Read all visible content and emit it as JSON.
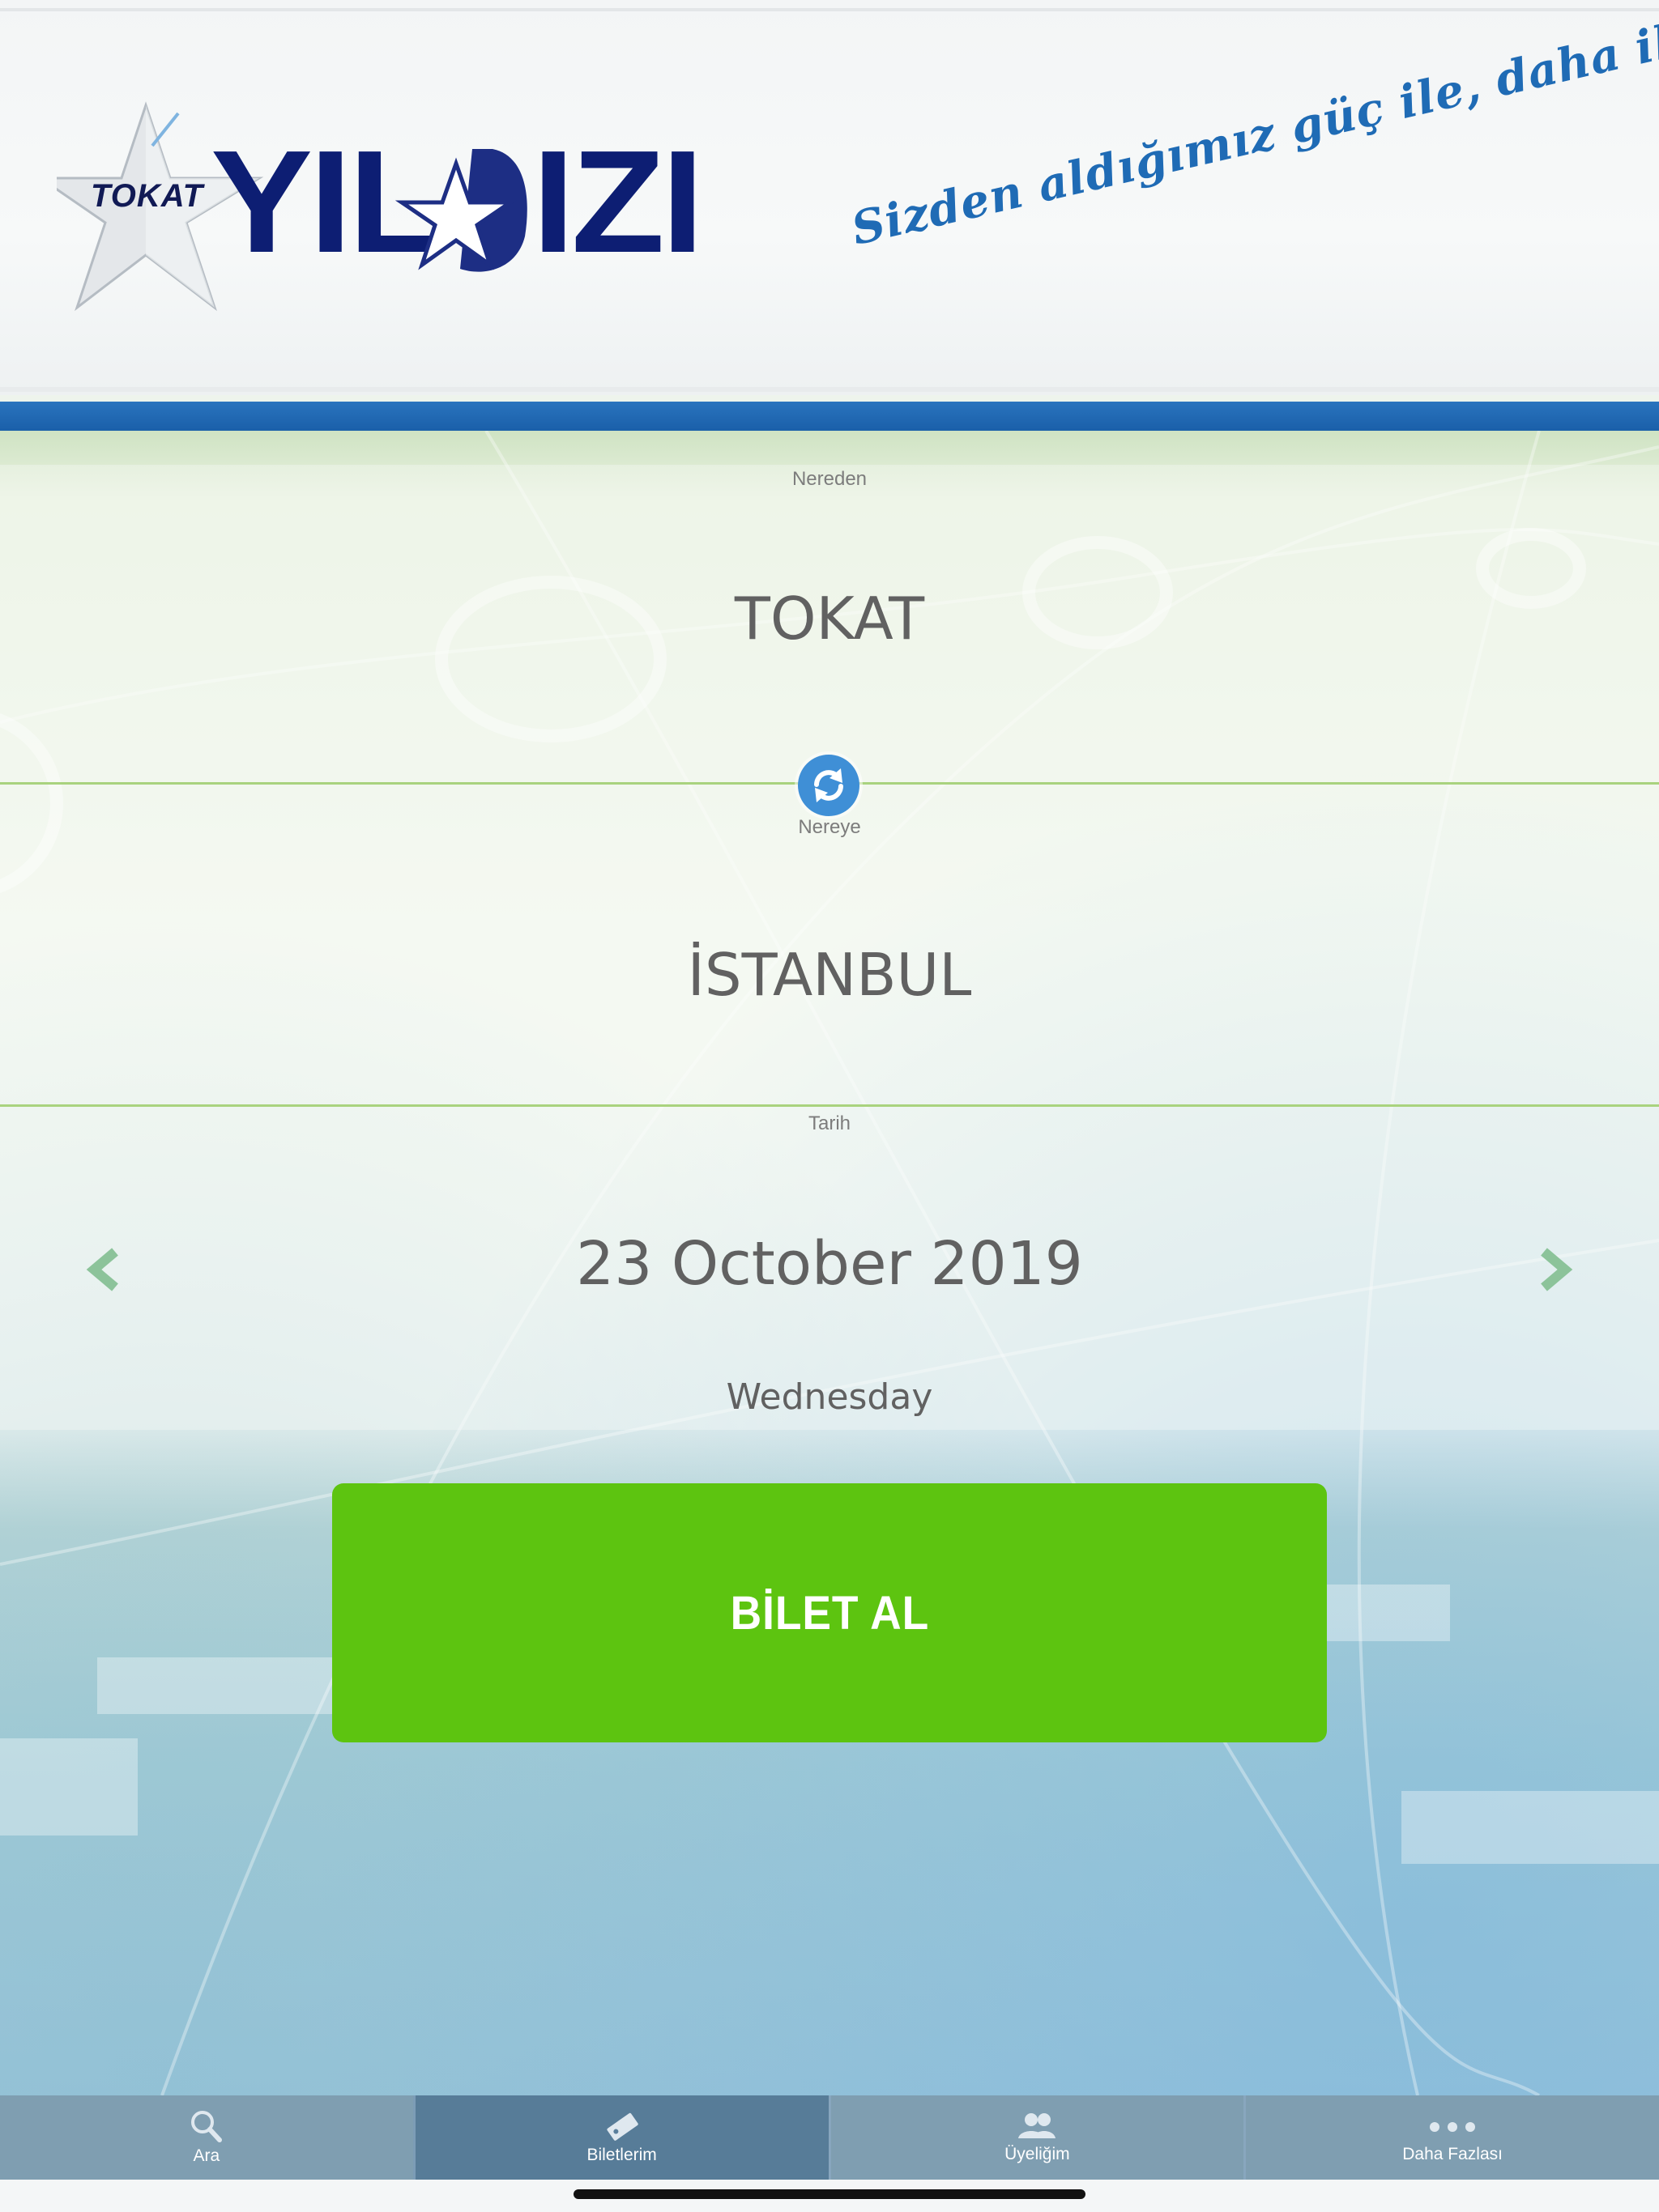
{
  "header": {
    "brand_small": "TOKAT",
    "brand_big_left": "YIL",
    "brand_big_right": "IZI",
    "slogan": "Sizden aldığımız güç ile, daha ileriye..."
  },
  "form": {
    "from_label": "Nereden",
    "from_value": "TOKAT",
    "swap_icon": "swap-icon",
    "to_label": "Nereye",
    "to_value": "İSTANBUL",
    "date_label": "Tarih",
    "date_value": "23 October 2019",
    "weekday": "Wednesday",
    "prev_icon": "chevron-left-icon",
    "next_icon": "chevron-right-icon"
  },
  "buy_button": {
    "label": "BİLET AL"
  },
  "colors": {
    "brand_navy": "#0d1e73",
    "header_blue_bar": "#1a5fa9",
    "swap_blue": "#3f8fd6",
    "buy_green": "#5dc410",
    "divider_green": "#a9d37e",
    "chevron_green": "#8cc39a"
  },
  "tabbar": {
    "tabs": [
      {
        "label": "Ara",
        "icon": "search-icon"
      },
      {
        "label": "Biletlerim",
        "icon": "ticket-icon"
      },
      {
        "label": "Üyeliğim",
        "icon": "users-icon"
      },
      {
        "label": "Daha Fazlası",
        "icon": "more-icon"
      }
    ]
  }
}
